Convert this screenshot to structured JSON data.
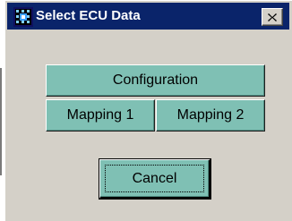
{
  "window": {
    "title": "Select ECU Data",
    "title_bar_color": "#0a246a",
    "icon": "ecu-app-icon",
    "close_icon": "close-x-icon"
  },
  "buttons": {
    "configuration_label": "Configuration",
    "mapping1_label": "Mapping 1",
    "mapping2_label": "Mapping 2",
    "cancel_label": "Cancel",
    "button_color": "#7fc0b4"
  }
}
